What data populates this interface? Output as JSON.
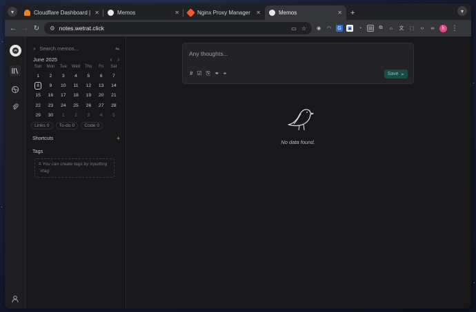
{
  "browser": {
    "tabs": [
      {
        "title": "Cloudflare Dashboard | ",
        "close": "✕"
      },
      {
        "title": "Memos",
        "close": "✕"
      },
      {
        "title": "Nginx Proxy Manager",
        "close": "✕"
      },
      {
        "title": "Memos",
        "close": "✕"
      }
    ],
    "new_tab_label": "+",
    "url": "notes.wetrat.click",
    "profile_initial": "h"
  },
  "sidebar": {
    "search_placeholder": "Search memos...",
    "calendar": {
      "month": "June 2025",
      "weekdays": [
        "Sun",
        "Mon",
        "Tue",
        "Wed",
        "Thu",
        "Fri",
        "Sat"
      ],
      "weeks": [
        [
          "1",
          "2",
          "3",
          "4",
          "5",
          "6",
          "7"
        ],
        [
          "8",
          "9",
          "10",
          "11",
          "12",
          "13",
          "14"
        ],
        [
          "15",
          "16",
          "17",
          "18",
          "19",
          "20",
          "21"
        ],
        [
          "22",
          "23",
          "24",
          "25",
          "26",
          "27",
          "28"
        ],
        [
          "29",
          "30",
          "1",
          "2",
          "3",
          "4",
          "5"
        ]
      ],
      "today": "8"
    },
    "stats": {
      "links": "Links 0",
      "todo": "To-do 0",
      "code": "Code 0"
    },
    "shortcuts_label": "Shortcuts",
    "tags_label": "Tags",
    "tags_hint": "You can create tags by inputting `#tag`"
  },
  "editor": {
    "placeholder": "Any thoughts...",
    "save_label": "Save"
  },
  "empty_state": {
    "message": "No data found."
  },
  "colors": {
    "accent": "#1d4a48",
    "background": "#18181b"
  }
}
